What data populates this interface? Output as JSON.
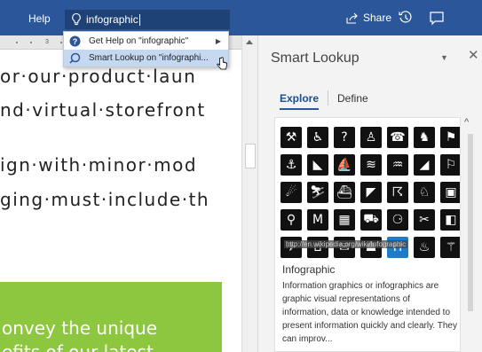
{
  "ribbon": {
    "help_label": "Help",
    "search_value": "infographic",
    "share_label": "Share"
  },
  "dropdown": {
    "items": [
      {
        "label": "Get Help on \"infographic\""
      },
      {
        "label": "Smart Lookup on \"infographi..."
      }
    ]
  },
  "document": {
    "ruler_number": "3",
    "lines": [
      "or·our·product·laun",
      "nd·virtual·storefront",
      "ign·with·minor·mod",
      "ging·must·include·th"
    ],
    "green_lines": [
      "onvey the unique",
      "efits of our latest"
    ]
  },
  "pane": {
    "title": "Smart Lookup",
    "tabs": [
      {
        "label": "Explore"
      },
      {
        "label": "Define"
      }
    ],
    "image_url": "http://en.wikipedia.org/wiki/Infographic",
    "result_title": "Infographic",
    "result_body": "Information graphics or infographics are graphic visual representations of information, data or knowledge intended to present information quickly and clearly. They can improv..."
  },
  "colors": {
    "ribbon": "#2b579a",
    "search_bg": "#1e4176",
    "highlight": "#c5d8ef",
    "green_box": "#8dc63f"
  }
}
